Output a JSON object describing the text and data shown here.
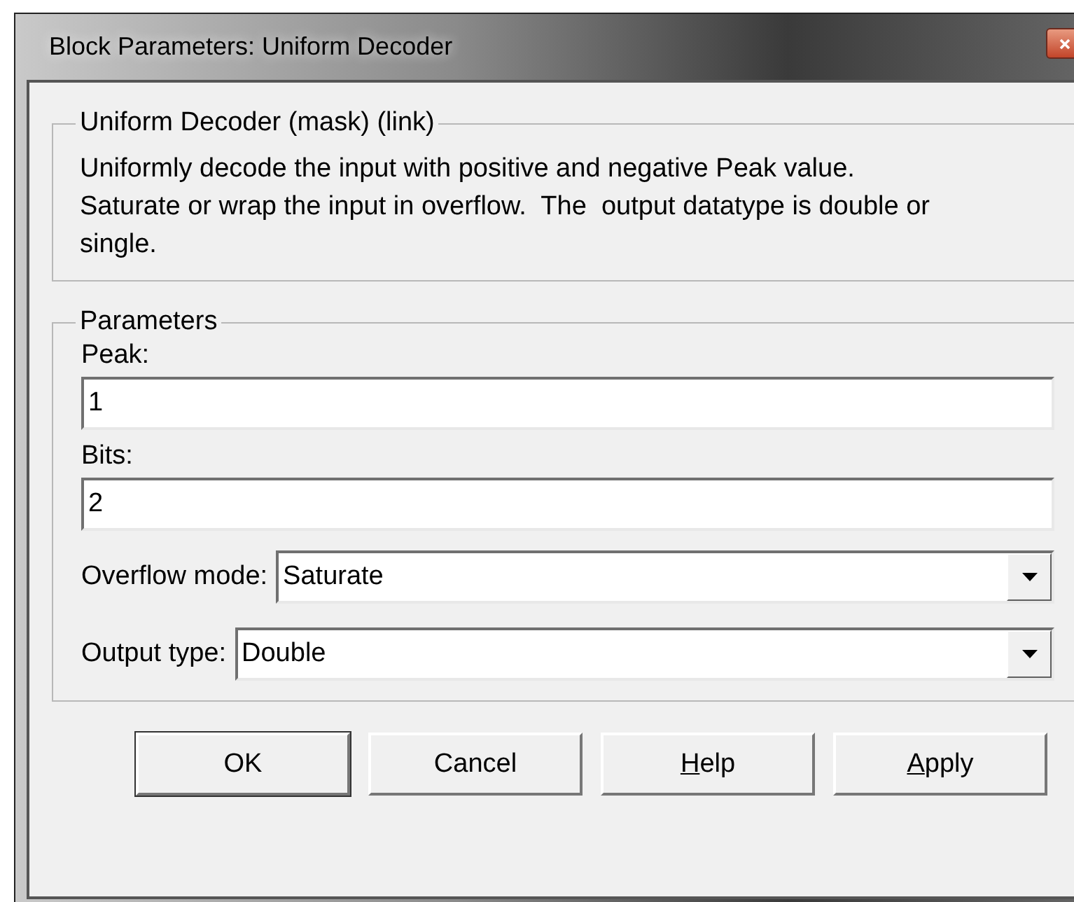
{
  "window": {
    "title": "Block Parameters: Uniform Decoder"
  },
  "description_group": {
    "title": "Uniform Decoder (mask) (link)",
    "text": "Uniformly decode the input with positive and negative Peak value.\nSaturate or wrap the input in overflow.  The  output datatype is double or single."
  },
  "parameters": {
    "title": "Parameters",
    "fields": [
      {
        "kind": "text",
        "label": "Peak:",
        "value": "1"
      },
      {
        "kind": "text",
        "label": "Bits:",
        "value": "2"
      },
      {
        "kind": "dropdown",
        "label": "Overflow mode:",
        "value": "Saturate"
      },
      {
        "kind": "dropdown",
        "label": "Output type:",
        "value": "Double"
      }
    ]
  },
  "buttons": [
    {
      "label": "OK",
      "mnemonic": false,
      "default": true
    },
    {
      "label": "Cancel",
      "mnemonic": false,
      "default": false
    },
    {
      "label": "Help",
      "mnemonic": true,
      "default": false
    },
    {
      "label": "Apply",
      "mnemonic": true,
      "default": false
    }
  ]
}
